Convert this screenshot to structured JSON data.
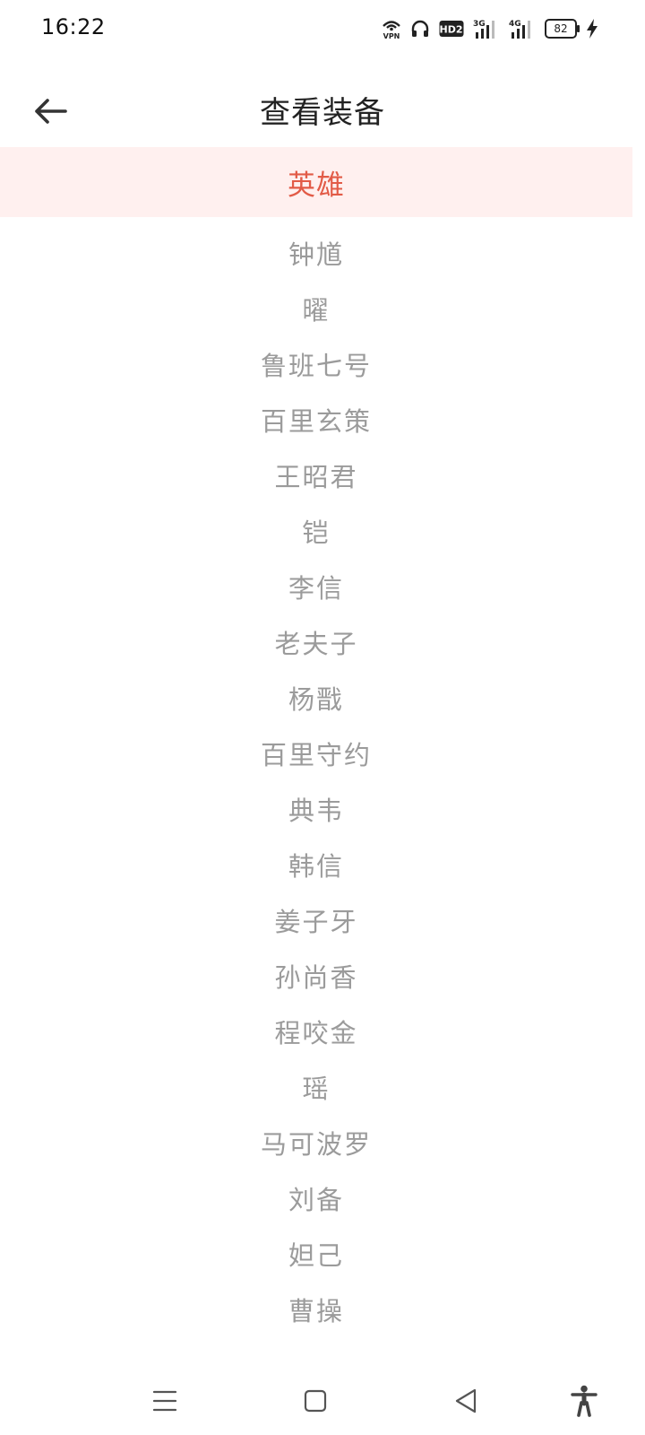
{
  "status_bar": {
    "time": "16:22",
    "icons": [
      "vpn-icon",
      "headset-icon",
      "hd2-icon",
      "signal-3g-icon",
      "signal-4g-icon",
      "battery-icon",
      "charging-icon"
    ],
    "battery_level": "82"
  },
  "header": {
    "title": "查看装备",
    "back_icon": "arrow-left-icon"
  },
  "category": {
    "label": "英雄",
    "accent_color": "#e25b47",
    "band_color": "#fff0ef"
  },
  "heroes": [
    "钟馗",
    "曜",
    "鲁班七号",
    "百里玄策",
    "王昭君",
    "铠",
    "李信",
    "老夫子",
    "杨戬",
    "百里守约",
    "典韦",
    "韩信",
    "姜子牙",
    "孙尚香",
    "程咬金",
    "瑶",
    "马可波罗",
    "刘备",
    "妲己",
    "曹操"
  ],
  "nav_bar": {
    "icons": [
      "menu-icon",
      "home-icon",
      "back-triangle-icon",
      "accessibility-icon"
    ]
  }
}
